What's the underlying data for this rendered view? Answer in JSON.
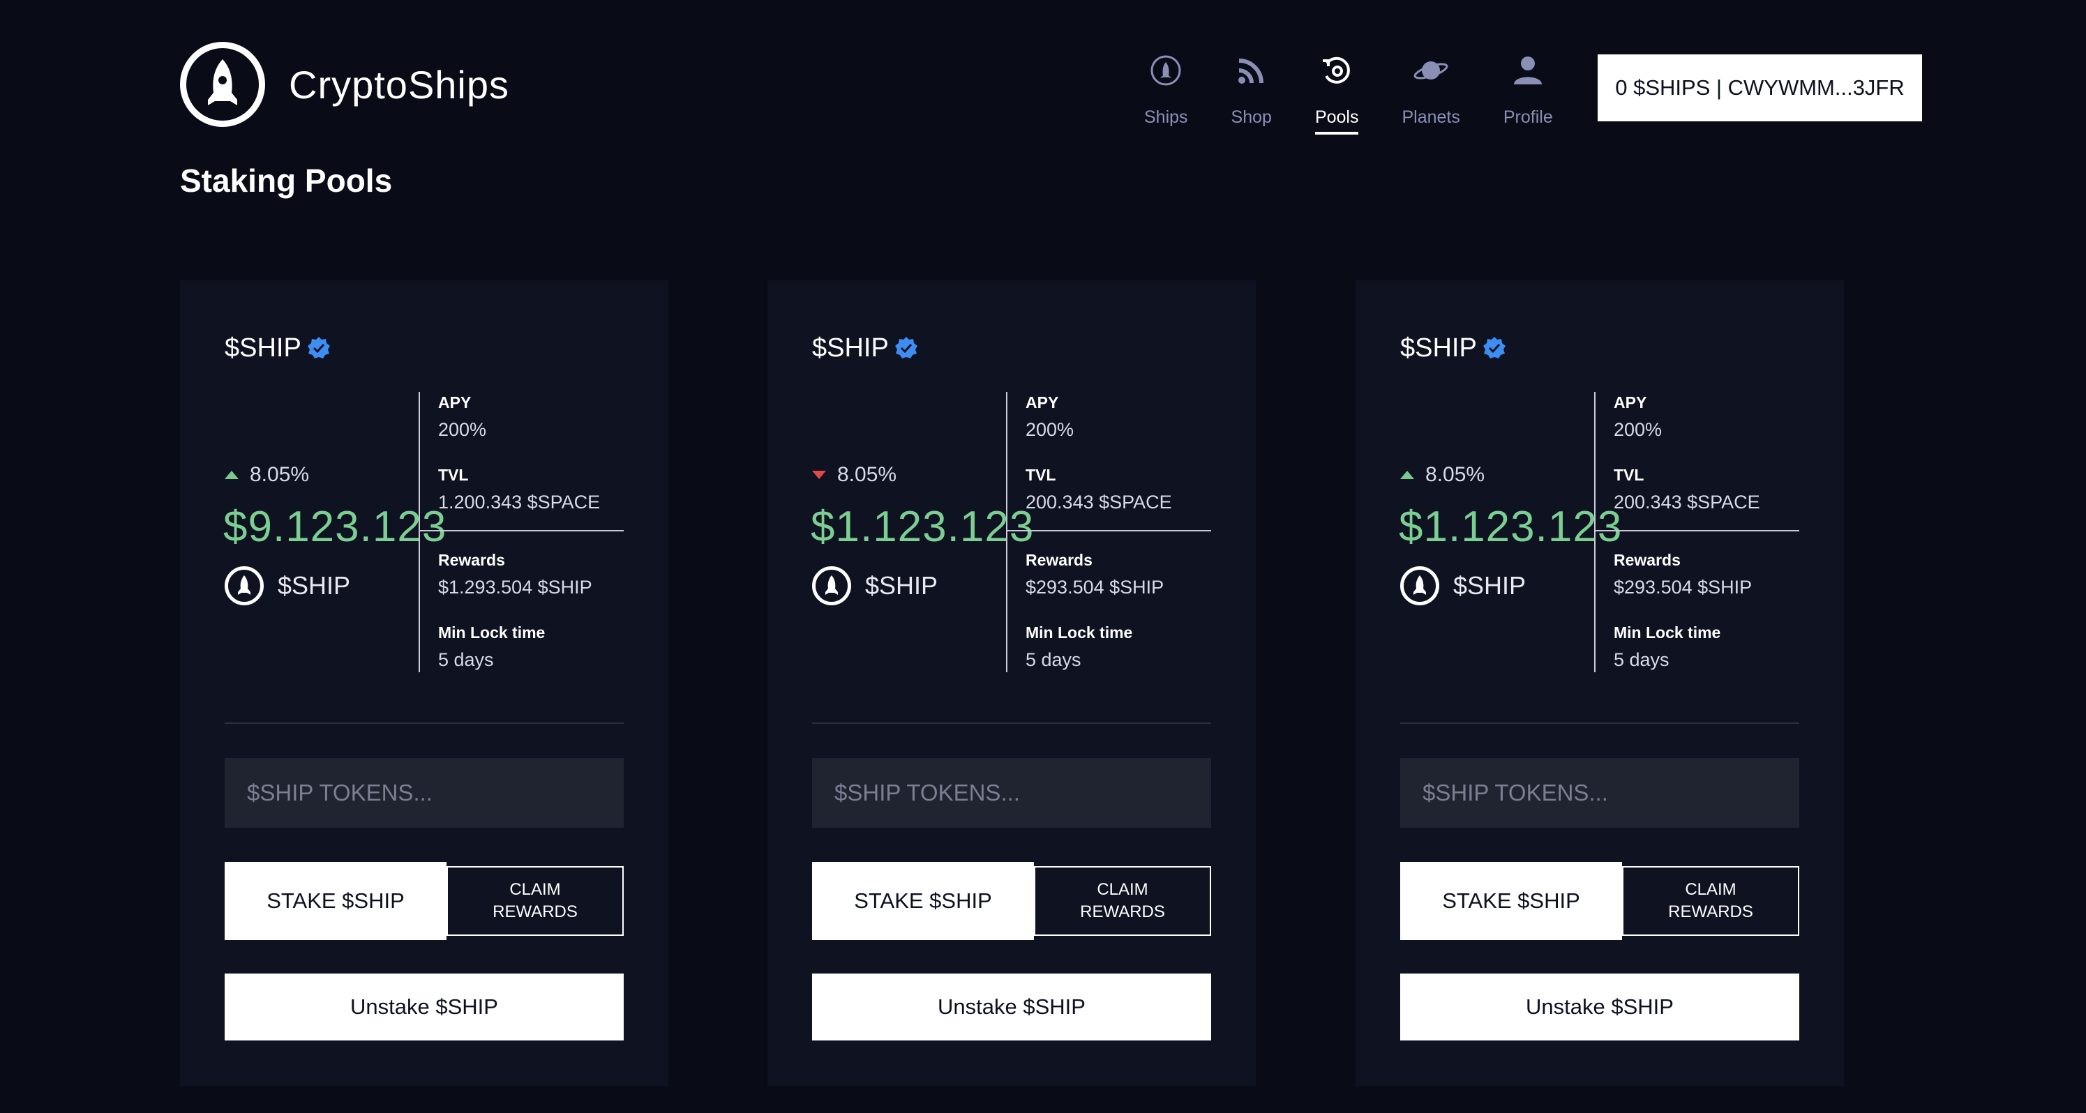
{
  "brand": {
    "name": "CryptoShips"
  },
  "nav": [
    {
      "label": "Ships",
      "icon": "ship-icon"
    },
    {
      "label": "Shop",
      "icon": "shop-icon"
    },
    {
      "label": "Pools",
      "icon": "pools-icon",
      "active": true
    },
    {
      "label": "Planets",
      "icon": "planet-icon"
    },
    {
      "label": "Profile",
      "icon": "profile-icon"
    }
  ],
  "wallet": {
    "label": "0 $SHIPS | CWYWMM...3JFR"
  },
  "page_title": "Staking Pools",
  "colors": {
    "background": "#090c17",
    "card": "#0f1220",
    "positive": "#7bcf93",
    "negative": "#e24a4a",
    "accent_verified": "#3d8df2"
  },
  "pools": [
    {
      "token": "$SHIP",
      "change": "8.05%",
      "direction": "up",
      "price": "$9.123.123",
      "token_symbol": "$SHIP",
      "apy_label": "APY",
      "apy": "200%",
      "tvl_label": "TVL",
      "tvl": "1.200.343 $SPACE",
      "rewards_label": "Rewards",
      "rewards": "$1.293.504 $SHIP",
      "lock_label": "Min Lock time",
      "lock": "5 days",
      "input_placeholder": "$SHIP TOKENS...",
      "stake_label": "STAKE $SHIP",
      "claim_label": "CLAIM\nREWARDS",
      "unstake_label": "Unstake $SHIP"
    },
    {
      "token": "$SHIP",
      "change": "8.05%",
      "direction": "down",
      "price": "$1.123.123",
      "token_symbol": "$SHIP",
      "apy_label": "APY",
      "apy": "200%",
      "tvl_label": "TVL",
      "tvl": "200.343 $SPACE",
      "rewards_label": "Rewards",
      "rewards": "$293.504 $SHIP",
      "lock_label": "Min Lock time",
      "lock": "5 days",
      "input_placeholder": "$SHIP TOKENS...",
      "stake_label": "STAKE $SHIP",
      "claim_label": "CLAIM\nREWARDS",
      "unstake_label": "Unstake $SHIP"
    },
    {
      "token": "$SHIP",
      "change": "8.05%",
      "direction": "up",
      "price": "$1.123.123",
      "token_symbol": "$SHIP",
      "apy_label": "APY",
      "apy": "200%",
      "tvl_label": "TVL",
      "tvl": "200.343 $SPACE",
      "rewards_label": "Rewards",
      "rewards": "$293.504 $SHIP",
      "lock_label": "Min Lock time",
      "lock": "5 days",
      "input_placeholder": "$SHIP TOKENS...",
      "stake_label": "STAKE $SHIP",
      "claim_label": "CLAIM\nREWARDS",
      "unstake_label": "Unstake $SHIP"
    }
  ]
}
